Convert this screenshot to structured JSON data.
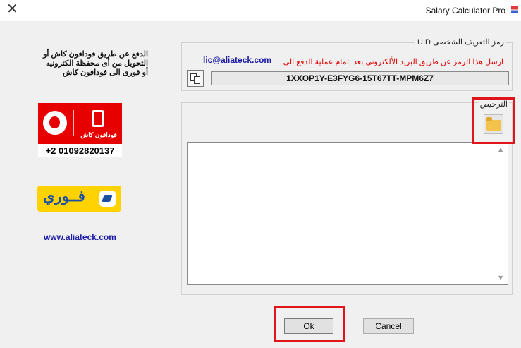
{
  "window": {
    "title": "Salary Calculator Pro",
    "close_glyph": "✕"
  },
  "payment_info": {
    "lines": [
      "الدفع عن طريق فودافون كاش أو",
      "التحويل من أى محفظة الكترونيه",
      "أو فورى الى فودافون كاش"
    ]
  },
  "vodafone": {
    "brand": "فودافون كاش",
    "phone": "+2 01092820137",
    "color": "#e60000"
  },
  "fawry": {
    "brand": "فــوري",
    "color": "#ffd200"
  },
  "website": "www.aliateck.com",
  "uid_group": {
    "legend": "رمز التعريف الشخصى UID",
    "instruction": "ارسل هذا الرمز عن طريق البريد الألكترونى بعد اتمام عملية الدفع الى",
    "email": "lic@aliateck.com",
    "uid_value": "1XXOP1Y-E3FYG6-15T67TT-MPM6Z7"
  },
  "license_group": {
    "legend": "الترخيص",
    "license_text": ""
  },
  "buttons": {
    "ok": "Ok",
    "cancel": "Cancel"
  },
  "icons": {
    "close": "close-icon",
    "copy": "copy-icon",
    "folder": "folder-icon"
  },
  "highlight_color": "#e0151c"
}
